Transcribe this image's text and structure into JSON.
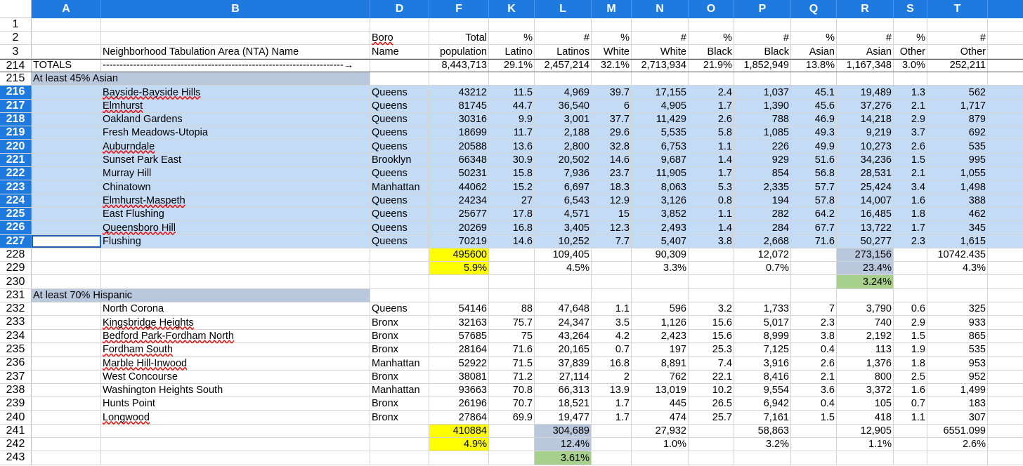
{
  "columns": [
    "A",
    "B",
    "D",
    "F",
    "K",
    "L",
    "M",
    "N",
    "O",
    "P",
    "Q",
    "R",
    "S",
    "T",
    ""
  ],
  "header_rows": [
    {
      "num": "1",
      "cells": [
        "",
        "",
        "",
        "",
        "",
        "",
        "",
        "",
        "",
        "",
        "",
        "",
        "",
        "",
        ""
      ]
    },
    {
      "num": "2",
      "cells": [
        "",
        "",
        "Boro",
        "Total",
        "%",
        "#",
        "%",
        "#",
        "%",
        "#",
        "%",
        "#",
        "%",
        "#",
        ""
      ]
    },
    {
      "num": "3",
      "cells": [
        "",
        "Neighborhood Tabulation Area (NTA) Name",
        "Name",
        "population",
        "Latino",
        "Latinos",
        "White",
        "White",
        "Black",
        "Black",
        "Asian",
        "Asian",
        "Other",
        "Other",
        ""
      ]
    }
  ],
  "totals_row": {
    "num": "214",
    "cells": [
      "TOTALS",
      "-----------------------------------------------------------------------→",
      "",
      "8,443,713",
      "29.1%",
      "2,457,214",
      "32.1%",
      "2,713,934",
      "21.9%",
      "1,852,949",
      "13.8%",
      "1,167,348",
      "3.0%",
      "252,211",
      ""
    ]
  },
  "asian_section": {
    "title_row": {
      "num": "215",
      "label": "At least 45% Asian"
    },
    "rows": [
      {
        "num": "216",
        "cells": [
          "",
          "Bayside-Bayside Hills",
          "Queens",
          "43212",
          "11.5",
          "4,969",
          "39.7",
          "17,155",
          "2.4",
          "1,037",
          "45.1",
          "19,489",
          "1.3",
          "562",
          ""
        ]
      },
      {
        "num": "217",
        "cells": [
          "",
          "Elmhurst",
          "Queens",
          "81745",
          "44.7",
          "36,540",
          "6",
          "4,905",
          "1.7",
          "1,390",
          "45.6",
          "37,276",
          "2.1",
          "1,717",
          ""
        ]
      },
      {
        "num": "218",
        "cells": [
          "",
          "Oakland Gardens",
          "Queens",
          "30316",
          "9.9",
          "3,001",
          "37.7",
          "11,429",
          "2.6",
          "788",
          "46.9",
          "14,218",
          "2.9",
          "879",
          ""
        ]
      },
      {
        "num": "219",
        "cells": [
          "",
          "Fresh Meadows-Utopia",
          "Queens",
          "18699",
          "11.7",
          "2,188",
          "29.6",
          "5,535",
          "5.8",
          "1,085",
          "49.3",
          "9,219",
          "3.7",
          "692",
          ""
        ]
      },
      {
        "num": "220",
        "cells": [
          "",
          "Auburndale",
          "Queens",
          "20588",
          "13.6",
          "2,800",
          "32.8",
          "6,753",
          "1.1",
          "226",
          "49.9",
          "10,273",
          "2.6",
          "535",
          ""
        ]
      },
      {
        "num": "221",
        "cells": [
          "",
          "Sunset Park East",
          "Brooklyn",
          "66348",
          "30.9",
          "20,502",
          "14.6",
          "9,687",
          "1.4",
          "929",
          "51.6",
          "34,236",
          "1.5",
          "995",
          ""
        ]
      },
      {
        "num": "222",
        "cells": [
          "",
          "Murray Hill",
          "Queens",
          "50231",
          "15.8",
          "7,936",
          "23.7",
          "11,905",
          "1.7",
          "854",
          "56.8",
          "28,531",
          "2.1",
          "1,055",
          ""
        ]
      },
      {
        "num": "223",
        "cells": [
          "",
          "Chinatown",
          "Manhattan",
          "44062",
          "15.2",
          "6,697",
          "18.3",
          "8,063",
          "5.3",
          "2,335",
          "57.7",
          "25,424",
          "3.4",
          "1,498",
          ""
        ]
      },
      {
        "num": "224",
        "cells": [
          "",
          "Elmhurst-Maspeth",
          "Queens",
          "24234",
          "27",
          "6,543",
          "12.9",
          "3,126",
          "0.8",
          "194",
          "57.8",
          "14,007",
          "1.6",
          "388",
          ""
        ]
      },
      {
        "num": "225",
        "cells": [
          "",
          "East Flushing",
          "Queens",
          "25677",
          "17.8",
          "4,571",
          "15",
          "3,852",
          "1.1",
          "282",
          "64.2",
          "16,485",
          "1.8",
          "462",
          ""
        ]
      },
      {
        "num": "226",
        "cells": [
          "",
          "Queensboro Hill",
          "Queens",
          "20269",
          "16.8",
          "3,405",
          "12.3",
          "2,493",
          "1.4",
          "284",
          "67.7",
          "13,722",
          "1.7",
          "345",
          ""
        ]
      },
      {
        "num": "227",
        "cells": [
          "",
          "Flushing",
          "Queens",
          "70219",
          "14.6",
          "10,252",
          "7.7",
          "5,407",
          "3.8",
          "2,668",
          "71.6",
          "50,277",
          "2.3",
          "1,615",
          ""
        ]
      }
    ],
    "sum_row": {
      "num": "228",
      "cells": [
        "",
        "",
        "",
        "495600",
        "",
        "109,405",
        "",
        "90,309",
        "",
        "12,072",
        "",
        "273,156",
        "",
        "10742.435",
        ""
      ]
    },
    "pct_row": {
      "num": "229",
      "cells": [
        "",
        "",
        "",
        "5.9%",
        "",
        "4.5%",
        "",
        "3.3%",
        "",
        "0.7%",
        "",
        "23.4%",
        "",
        "4.3%",
        ""
      ]
    },
    "extra_row": {
      "num": "230",
      "cells": [
        "",
        "",
        "",
        "",
        "",
        "",
        "",
        "",
        "",
        "",
        "",
        "3.24%",
        "",
        "",
        ""
      ]
    }
  },
  "hispanic_section": {
    "title_row": {
      "num": "231",
      "label": "At least 70% Hispanic"
    },
    "rows": [
      {
        "num": "232",
        "cells": [
          "",
          "North Corona",
          "Queens",
          "54146",
          "88",
          "47,648",
          "1.1",
          "596",
          "3.2",
          "1,733",
          "7",
          "3,790",
          "0.6",
          "325",
          ""
        ]
      },
      {
        "num": "233",
        "cells": [
          "",
          "Kingsbridge Heights",
          "Bronx",
          "32163",
          "75.7",
          "24,347",
          "3.5",
          "1,126",
          "15.6",
          "5,017",
          "2.3",
          "740",
          "2.9",
          "933",
          ""
        ]
      },
      {
        "num": "234",
        "cells": [
          "",
          "Bedford Park-Fordham North",
          "Bronx",
          "57685",
          "75",
          "43,264",
          "4.2",
          "2,423",
          "15.6",
          "8,999",
          "3.8",
          "2,192",
          "1.5",
          "865",
          ""
        ]
      },
      {
        "num": "235",
        "cells": [
          "",
          "Fordham South",
          "Bronx",
          "28164",
          "71.6",
          "20,165",
          "0.7",
          "197",
          "25.3",
          "7,125",
          "0.4",
          "113",
          "1.9",
          "535",
          ""
        ]
      },
      {
        "num": "236",
        "cells": [
          "",
          "Marble Hill-Inwood",
          "Manhattan",
          "52922",
          "71.5",
          "37,839",
          "16.8",
          "8,891",
          "7.4",
          "3,916",
          "2.6",
          "1,376",
          "1.8",
          "953",
          ""
        ]
      },
      {
        "num": "237",
        "cells": [
          "",
          "West Concourse",
          "Bronx",
          "38081",
          "71.2",
          "27,114",
          "2",
          "762",
          "22.1",
          "8,416",
          "2.1",
          "800",
          "2.5",
          "952",
          ""
        ]
      },
      {
        "num": "238",
        "cells": [
          "",
          "Washington Heights South",
          "Manhattan",
          "93663",
          "70.8",
          "66,313",
          "13.9",
          "13,019",
          "10.2",
          "9,554",
          "3.6",
          "3,372",
          "1.6",
          "1,499",
          ""
        ]
      },
      {
        "num": "239",
        "cells": [
          "",
          "Hunts Point",
          "Bronx",
          "26196",
          "70.7",
          "18,521",
          "1.7",
          "445",
          "26.5",
          "6,942",
          "0.4",
          "105",
          "0.7",
          "183",
          ""
        ]
      },
      {
        "num": "240",
        "cells": [
          "",
          "Longwood",
          "Bronx",
          "27864",
          "69.9",
          "19,477",
          "1.7",
          "474",
          "25.7",
          "7,161",
          "1.5",
          "418",
          "1.1",
          "307",
          ""
        ]
      }
    ],
    "sum_row": {
      "num": "241",
      "cells": [
        "",
        "",
        "",
        "410884",
        "",
        "304,689",
        "",
        "27,932",
        "",
        "58,863",
        "",
        "12,905",
        "",
        "6551.099",
        ""
      ]
    },
    "pct_row": {
      "num": "242",
      "cells": [
        "",
        "",
        "",
        "4.9%",
        "",
        "12.4%",
        "",
        "1.0%",
        "",
        "3.2%",
        "",
        "1.1%",
        "",
        "2.6%",
        ""
      ]
    },
    "extra_row": {
      "num": "243",
      "cells": [
        "",
        "",
        "",
        "",
        "",
        "3.61%",
        "",
        "",
        "",
        "",
        "",
        "",
        "",
        "",
        ""
      ]
    }
  },
  "colors": {
    "header_blue": "#1f7ae0",
    "selection": "#c4dbf5",
    "yellow": "#ffff00",
    "gray_blue": "#b9c8dd",
    "green": "#a8d08d"
  }
}
